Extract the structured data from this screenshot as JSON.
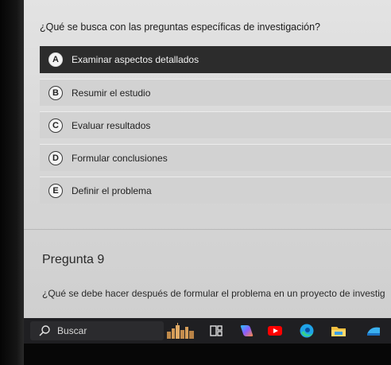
{
  "question": "¿Qué se busca con las preguntas específicas de investigación?",
  "options": [
    {
      "letter": "A",
      "text": "Examinar aspectos detallados",
      "selected": true
    },
    {
      "letter": "B",
      "text": "Resumir el estudio",
      "selected": false
    },
    {
      "letter": "C",
      "text": "Evaluar resultados",
      "selected": false
    },
    {
      "letter": "D",
      "text": "Formular conclusiones",
      "selected": false
    },
    {
      "letter": "E",
      "text": "Definir el problema",
      "selected": false
    }
  ],
  "next_question": {
    "title": "Pregunta 9",
    "text": "¿Qué se debe hacer después de formular el problema en un proyecto de investig"
  },
  "taskbar": {
    "search_placeholder": "Buscar",
    "icons": [
      "city-widget-icon",
      "task-view-icon",
      "copilot-icon",
      "youtube-icon",
      "edge-icon",
      "file-explorer-icon",
      "app-icon"
    ]
  }
}
